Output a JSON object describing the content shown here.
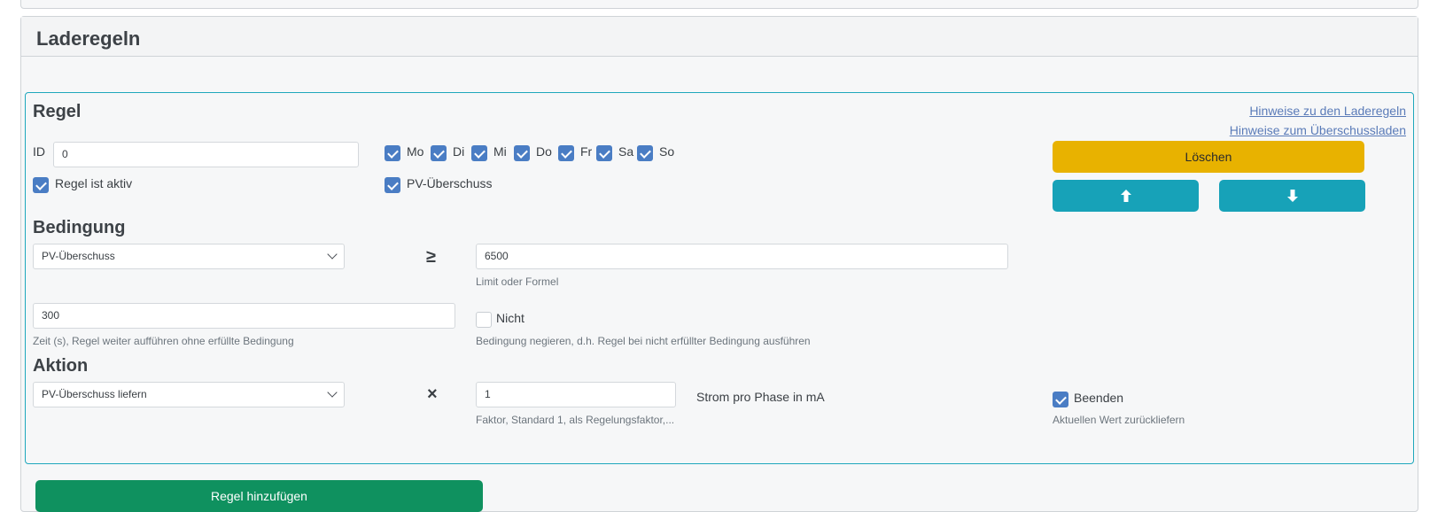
{
  "page": {
    "title": "Laderegeln"
  },
  "rule": {
    "title": "Regel",
    "links": {
      "help_rules": "Hinweise zu den Laderegeln",
      "help_surplus": "Hinweise zum Überschussladen"
    },
    "id_label": "ID",
    "id_value": "0",
    "days": [
      {
        "label": "Mo",
        "checked": true
      },
      {
        "label": "Di",
        "checked": true
      },
      {
        "label": "Mi",
        "checked": true
      },
      {
        "label": "Do",
        "checked": true
      },
      {
        "label": "Fr",
        "checked": true
      },
      {
        "label": "Sa",
        "checked": true
      },
      {
        "label": "So",
        "checked": true
      }
    ],
    "active_label": "Regel ist aktiv",
    "active_checked": true,
    "surplus_label": "PV-Überschuss",
    "surplus_checked": true,
    "buttons": {
      "delete": "Löschen",
      "move_up_icon": "arrow-up-icon",
      "move_down_icon": "arrow-down-icon"
    }
  },
  "condition": {
    "title": "Bedingung",
    "source_selected": "PV-Überschuss",
    "operator": "≥",
    "limit_value": "6500",
    "limit_help": "Limit oder Formel",
    "time_value": "300",
    "time_help": "Zeit (s), Regel weiter aufführen ohne erfüllte Bedingung",
    "negate_label": "Nicht",
    "negate_checked": false,
    "negate_help": "Bedingung negieren, d.h. Regel bei nicht erfüllter Bedingung ausführen"
  },
  "action": {
    "title": "Aktion",
    "action_selected": "PV-Überschuss liefern",
    "operator": "×",
    "factor_value": "1",
    "factor_help": "Faktor, Standard 1, als Regelungsfaktor,...",
    "unit_label": "Strom pro Phase in mA",
    "finish_label": "Beenden",
    "finish_checked": true,
    "finish_help": "Aktuellen Wert zurückliefern"
  },
  "footer": {
    "add_rule": "Regel hinzufügen"
  },
  "colors": {
    "accent_teal": "#17a2b8",
    "warning": "#e8b200",
    "success": "#0f915f",
    "checkbox": "#4a7dc4"
  }
}
